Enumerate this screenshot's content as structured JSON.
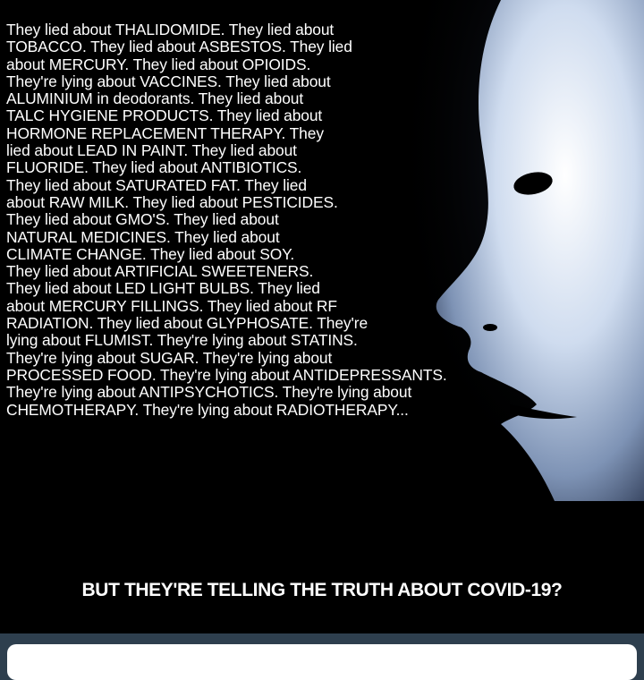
{
  "poster": {
    "lines": [
      "They lied about THALIDOMIDE. They lied about",
      "TOBACCO. They lied about ASBESTOS. They lied",
      "about MERCURY. They lied about OPIOIDS.",
      "They're lying about VACCINES. They lied about",
      "ALUMINIUM in deodorants. They lied about",
      "TALC HYGIENE PRODUCTS. They lied about",
      "HORMONE REPLACEMENT THERAPY. They",
      "lied about LEAD IN PAINT. They lied about",
      "FLUORIDE. They lied about ANTIBIOTICS.",
      "They lied about SATURATED FAT. They lied",
      "about RAW MILK. They lied about PESTICIDES.",
      "They lied about GMO'S. They lied about",
      "NATURAL MEDICINES. They lied about",
      "CLIMATE CHANGE. They lied about SOY.",
      "They lied about ARTIFICIAL SWEETENERS.",
      "They lied about LED LIGHT BULBS. They lied",
      "about MERCURY FILLINGS. They lied about RF",
      "RADIATION. They lied about GLYPHOSATE. They're",
      "lying about FLUMIST. They're lying about STATINS.",
      "They're lying about SUGAR. They're lying about",
      "PROCESSED FOOD. They're lying about ANTIDEPRESSANTS.",
      "They're lying about ANTIPSYCHOTICS. They're lying about",
      "CHEMOTHERAPY. They're lying about RADIOTHERAPY..."
    ],
    "closing": "BUT THEY'RE TELLING THE TRUTH ABOUT COVID-19?",
    "image": "white-mask-face-profile",
    "colors": {
      "background": "#000000",
      "text": "#ffffff",
      "mask": "#dfe9f5",
      "frame": "#2e3f4e"
    }
  }
}
